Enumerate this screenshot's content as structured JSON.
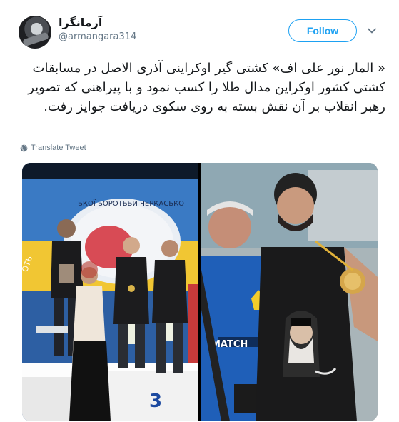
{
  "user": {
    "display_name": "آرمانگرا",
    "handle": "@armangara314"
  },
  "actions": {
    "follow_label": "Follow",
    "translate_label": "Translate Tweet"
  },
  "icons": {
    "more": "chevron-down-icon",
    "translate": "globe-icon"
  },
  "tweet": {
    "text": "« المار نور علی اف» کشتی گیر اوکراینی آذری الاصل در مسابقات کشتی کشور اوکراین مدال طلا را کسب نمود و با پیراهنی که تصویر رهبر انقلاب بر آن نقش بسته به روی سکوی دریافت جوایز رفت."
  },
  "media": {
    "left_photo": {
      "podium_number": "3",
      "banner_text": "ЬКОЇ БОРОТЬБИ ЧЕРКАСЬКО",
      "banner_side": "ОТЬ"
    },
    "right_photo": {
      "shirt_text": "MATCH"
    }
  },
  "colors": {
    "accent": "#1da1f2",
    "text": "#14171a",
    "muted": "#657786"
  }
}
